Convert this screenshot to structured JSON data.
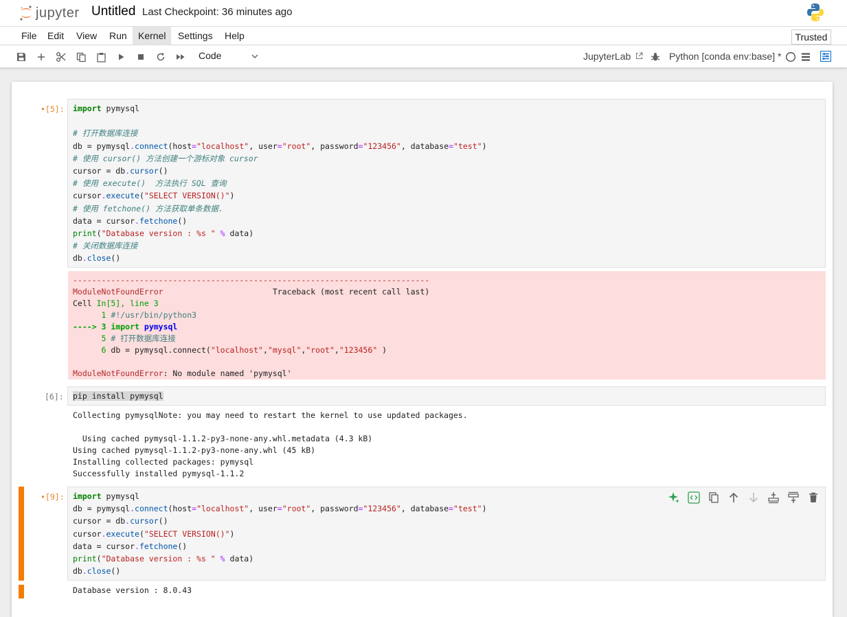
{
  "header": {
    "logo_text": "jupyter",
    "notebook_title": "Untitled",
    "checkpoint": "Last Checkpoint: 36 minutes ago"
  },
  "menu": {
    "items": [
      "File",
      "Edit",
      "View",
      "Run",
      "Kernel",
      "Settings",
      "Help"
    ],
    "active": "Kernel",
    "trusted": "Trusted"
  },
  "toolbar": {
    "cell_type": "Code",
    "jupyterlab_link": "JupyterLab",
    "kernel_name": "Python [conda env:base] *",
    "icons": [
      "save-icon",
      "add-cell-icon",
      "cut-icon",
      "copy-icon",
      "paste-icon",
      "run-icon",
      "stop-icon",
      "restart-icon",
      "fast-forward-icon"
    ]
  },
  "cells": [
    {
      "prompt": "•[5]:",
      "source": [
        "import pymysql",
        "",
        "# 打开数据库连接",
        "db = pymysql.connect(host=\"localhost\", user=\"root\", password=\"123456\", database=\"test\")",
        "# 使用 cursor() 方法创建一个游标对象 cursor",
        "cursor = db.cursor()",
        "# 使用 execute()  方法执行 SQL 查询",
        "cursor.execute(\"SELECT VERSION()\")",
        "# 使用 fetchone() 方法获取单条数据.",
        "data = cursor.fetchone()",
        "print(\"Database version : %s \" % data)",
        "# 关闭数据库连接",
        "db.close()"
      ],
      "error": {
        "dashes": "---------------------------------------------------------------------------",
        "name": "ModuleNotFoundError",
        "traceback_label": "Traceback (most recent call last)",
        "cell_ref": "Cell In[5], line 3",
        "lines": [
          "      1 #!/usr/bin/python3",
          "----> 3 import pymysql",
          "      5 # 打开数据库连接",
          "      6 db = pymysql.connect(\"localhost\",\"mysql\",\"root\",\"123456\" )"
        ],
        "message": "ModuleNotFoundError: No module named 'pymysql'"
      }
    },
    {
      "prompt": "[6]:",
      "source": [
        "pip install pymysql"
      ],
      "output": [
        "Collecting pymysqlNote: you may need to restart the kernel to use updated packages.",
        "",
        "  Using cached pymysql-1.1.2-py3-none-any.whl.metadata (4.3 kB)",
        "Using cached pymysql-1.1.2-py3-none-any.whl (45 kB)",
        "Installing collected packages: pymysql",
        "Successfully installed pymysql-1.1.2"
      ]
    },
    {
      "prompt": "•[9]:",
      "source": [
        "import pymysql",
        "db = pymysql.connect(host=\"localhost\", user=\"root\", password=\"123456\", database=\"test\")",
        "cursor = db.cursor()",
        "cursor.execute(\"SELECT VERSION()\")",
        "data = cursor.fetchone()",
        "print(\"Database version : %s \" % data)",
        "db.close()"
      ],
      "output": [
        "Database version : 8.0.43"
      ],
      "cell_toolbar_icons": [
        "ai-sparkle-icon",
        "format-code-icon",
        "duplicate-cell-icon",
        "move-up-icon",
        "move-down-icon",
        "insert-above-icon",
        "insert-below-icon",
        "delete-cell-icon"
      ]
    }
  ],
  "colors": {
    "accent": "#f57c00",
    "error_bg": "#fddddd",
    "keyword": "#008000",
    "string": "#ba2121",
    "comment": "#408080"
  }
}
